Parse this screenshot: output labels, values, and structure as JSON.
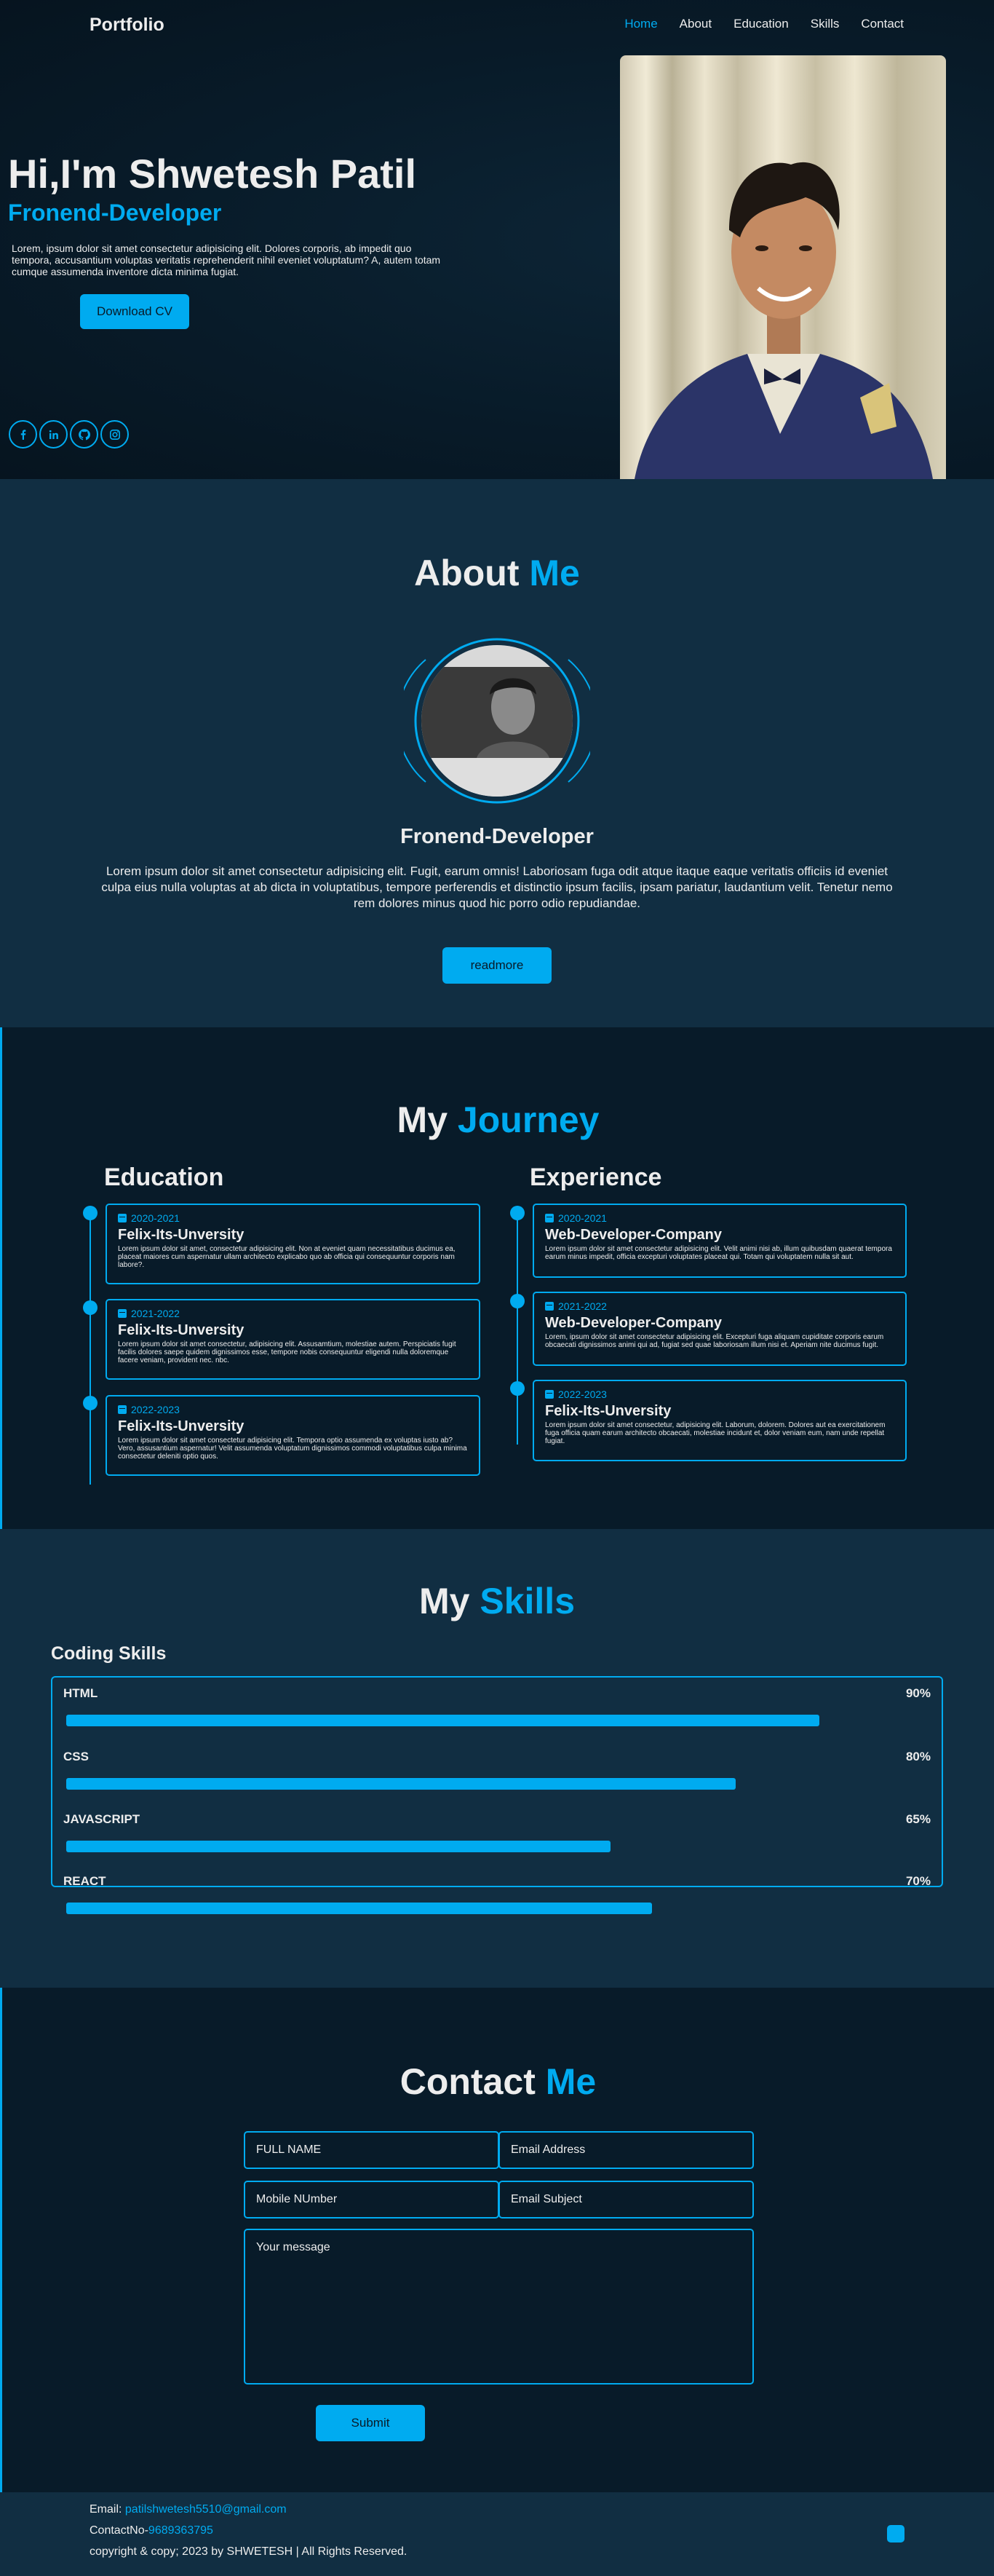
{
  "header": {
    "logo": "Portfolio",
    "nav": [
      "Home",
      "About",
      "Education",
      "Skills",
      "Contact"
    ]
  },
  "home": {
    "title": "Hi,I'm Shwetesh Patil",
    "role": "Fronend-Developer",
    "text": "Lorem, ipsum dolor sit amet consectetur adipisicing elit. Dolores corporis, ab impedit quo tempora, accusantium voluptas veritatis reprehenderit nihil eveniet voluptatum? A, autem totam cumque assumenda inventore dicta minima fugiat.",
    "download_label": "Download CV",
    "socials": [
      "facebook-icon",
      "linkedin-icon",
      "github-icon",
      "instagram-icon"
    ]
  },
  "about": {
    "title_main": "About",
    "title_accent": "Me",
    "role": "Fronend-Developer",
    "text": "Lorem ipsum dolor sit amet consectetur adipisicing elit. Fugit, earum omnis! Laboriosam fuga odit atque itaque eaque veritatis officiis id eveniet culpa eius nulla voluptas at ab dicta in voluptatibus, tempore perferendis et distinctio ipsum facilis, ipsam pariatur, laudantium velit. Tenetur nemo rem dolores minus quod hic porro odio repudiandae.",
    "readmore_label": "readmore"
  },
  "journey": {
    "title_main": "My",
    "title_accent": "Journey",
    "education_title": "Education",
    "experience_title": "Experience",
    "education": [
      {
        "year": "2020-2021",
        "name": "Felix-Its-Unversity",
        "text": "Lorem ipsum dolor sit amet, consectetur adipisicing elit. Non at eveniet quam necessitatibus ducimus ea, placeat maiores cum aspernatur ullam architecto explicabo quo ab officia qui consequuntur corporis nam labore?."
      },
      {
        "year": "2021-2022",
        "name": "Felix-Its-Unversity",
        "text": "Lorem ipsum dolor sit amet consectetur, adipisicing elit. Assusamtium, molestiae autem. Perspiciatis fugit facilis dolores saepe quidem dignissimos esse, tempore nobis consequuntur eligendi nulla doloremque facere veniam, provident nec. nbc."
      },
      {
        "year": "2022-2023",
        "name": "Felix-Its-Unversity",
        "text": "Lorem ipsum dolor sit amet consectetur adipisicing elit. Tempora optio assumenda ex voluptas iusto ab? Vero, assusantium aspernatur! Velit assumenda voluptatum dignissimos commodi voluptatibus culpa minima consectetur deleniti optio quos."
      }
    ],
    "experience": [
      {
        "year": "2020-2021",
        "name": "Web-Developer-Company",
        "text": "Lorem ipsum dolor sit amet consectetur adipisicing elit. Velit animi nisi ab, illum quibusdam quaerat tempora earum minus impedit, officia excepturi voluptates placeat qui. Totam qui voluptatem nulla sit aut."
      },
      {
        "year": "2021-2022",
        "name": "Web-Developer-Company",
        "text": "Lorem, ipsum dolor sit amet consectetur adipisicing elit. Excepturi fuga aliquam cupiditate corporis earum obcaecati dignissimos animi qui ad, fugiat sed quae laboriosam illum nisi et. Aperiam nite ducimus fugit."
      },
      {
        "year": "2022-2023",
        "name": "Felix-Its-Unversity",
        "text": "Lorem ipsum dolor sit amet consectetur, adipisicing elit. Laborum, dolorem. Dolores aut ea exercitationem fuga officia quam earum architecto obcaecati, molestiae incidunt et, dolor veniam eum, nam unde repellat fugiat."
      }
    ]
  },
  "skills": {
    "title_main": "My",
    "title_accent": "Skills",
    "coding_title": "Coding Skills",
    "items": [
      {
        "name": "HTML",
        "percent_label": "90%",
        "level": 0.9
      },
      {
        "name": "CSS",
        "percent_label": "80%",
        "level": 0.8
      },
      {
        "name": "JAVASCRIPT",
        "percent_label": "65%",
        "level": 0.65
      },
      {
        "name": "REACT",
        "percent_label": "70%",
        "level": 0.7
      }
    ]
  },
  "contact": {
    "title_main": "Contact",
    "title_accent": "Me",
    "fullname_placeholder": "FULL NAME",
    "email_placeholder": "Email Address",
    "mobile_placeholder": "Mobile NUmber",
    "subject_placeholder": "Email Subject",
    "message_placeholder": "Your message",
    "submit_label": "Submit"
  },
  "footer": {
    "email_label": "Email:",
    "email": "patilshwetesh5510@gmail.com",
    "contact_label": "ContactNo-",
    "contact": "9689363795",
    "copyright": "copyright & copy; 2023 by SHWETESH | All Rights Reserved."
  },
  "colors": {
    "accent": "#00abf0",
    "bg": "#081b29",
    "bg2": "#112e42",
    "text": "#ededed"
  }
}
